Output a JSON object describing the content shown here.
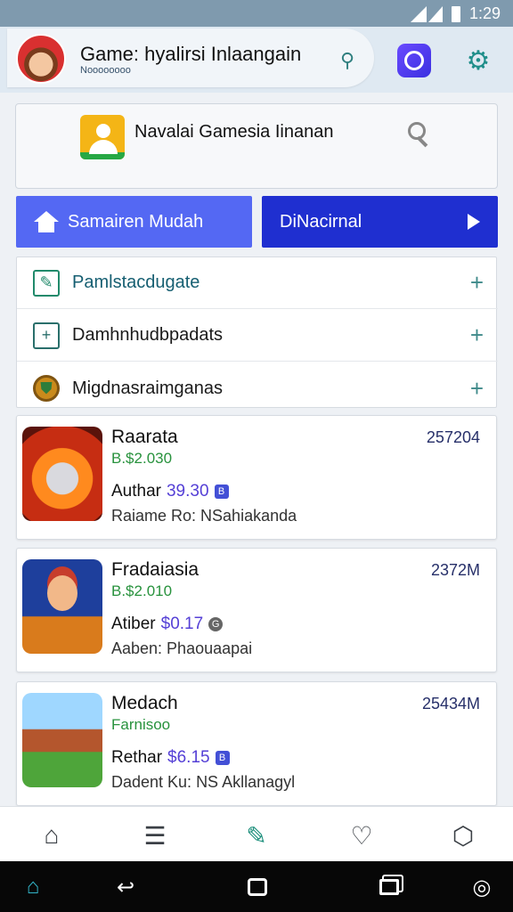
{
  "status_bar": {
    "time": "1:29"
  },
  "app_bar": {
    "title": "Game: hyalirsi Inlaangain",
    "subtitle": "Noooooooo",
    "icons": [
      "avatar",
      "pin-icon",
      "camera-icon",
      "settings-icon"
    ]
  },
  "search": {
    "text": "Navalai Gamesia Iinanan"
  },
  "buttons": {
    "home_label": "Samairen Mudah",
    "next_label": "DiNacirnal"
  },
  "categories": [
    {
      "label": "Pamlstacdugate",
      "icon": "edit-icon"
    },
    {
      "label": "Damhnhudbpadats",
      "icon": "add-box-icon"
    },
    {
      "label": "Migdnasraimganas",
      "icon": "shield-icon"
    }
  ],
  "games": [
    {
      "title": "Raarata",
      "code": "257204",
      "price": "B.$2.030",
      "author_label": "Authar",
      "author_value": "39.30",
      "badge": "B",
      "desc": "Raiame Ro: NSahiakanda"
    },
    {
      "title": "Fradaiasia",
      "code": "2372M",
      "price": "B.$2.010",
      "author_label": "Atiber",
      "author_value": "$0.17",
      "badge": "G",
      "desc": "Aaben: Phaouaapai"
    },
    {
      "title": "Medach",
      "code": "25434M",
      "price": "Farnisoo",
      "author_label": "Rethar",
      "author_value": "$6.15",
      "badge": "B",
      "desc": "Dadent Ku: NS Akllanagyl"
    }
  ],
  "bottom_nav": [
    "home-icon",
    "list-icon",
    "edit-icon",
    "heart-icon",
    "box-icon"
  ],
  "system_nav": [
    "home-icon",
    "back-icon",
    "recents-icon",
    "overview-icon",
    "assistant-icon"
  ]
}
